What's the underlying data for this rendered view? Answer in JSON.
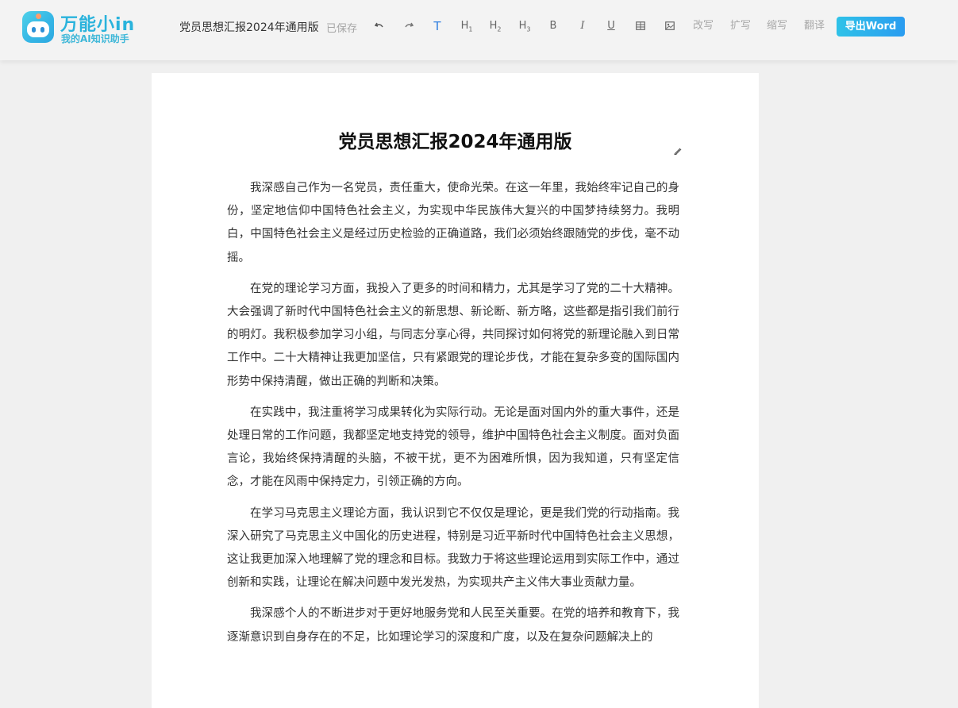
{
  "app": {
    "logo_title": "万能小in",
    "logo_subtitle": "我的AI知识助手"
  },
  "header": {
    "document_name": "党员思想汇报2024年通用版",
    "save_status": "已保存",
    "toolbar": {
      "undo_icon": "undo-icon",
      "redo_icon": "redo-icon",
      "text_style": "T",
      "h1": "H",
      "h1_sub": "1",
      "h2": "H",
      "h2_sub": "2",
      "h3": "H",
      "h3_sub": "3",
      "bold": "B",
      "italic": "I",
      "underline": "U",
      "table_icon": "table-icon",
      "image_icon": "image-icon",
      "rewrite": "改写",
      "expand": "扩写",
      "shorten": "缩写",
      "translate": "翻译",
      "export": "导出Word"
    },
    "colors": {
      "accent": "#2f7fe0",
      "export_start": "#2fc2e8",
      "export_end": "#2a9cf0",
      "logo": "#2ab3dc"
    }
  },
  "document": {
    "title": "党员思想汇报2024年通用版",
    "paragraphs": [
      "我深感自己作为一名党员，责任重大，使命光荣。在这一年里，我始终牢记自己的身份，坚定地信仰中国特色社会主义，为实现中华民族伟大复兴的中国梦持续努力。我明白，中国特色社会主义是经过历史检验的正确道路，我们必须始终跟随党的步伐，毫不动摇。",
      "在党的理论学习方面，我投入了更多的时间和精力，尤其是学习了党的二十大精神。大会强调了新时代中国特色社会主义的新思想、新论断、新方略，这些都是指引我们前行的明灯。我积极参加学习小组，与同志分享心得，共同探讨如何将党的新理论融入到日常工作中。二十大精神让我更加坚信，只有紧跟党的理论步伐，才能在复杂多变的国际国内形势中保持清醒，做出正确的判断和决策。",
      "在实践中，我注重将学习成果转化为实际行动。无论是面对国内外的重大事件，还是处理日常的工作问题，我都坚定地支持党的领导，维护中国特色社会主义制度。面对负面言论，我始终保持清醒的头脑，不被干扰，更不为困难所惧，因为我知道，只有坚定信念，才能在风雨中保持定力，引领正确的方向。",
      "在学习马克思主义理论方面，我认识到它不仅仅是理论，更是我们党的行动指南。我深入研究了马克思主义中国化的历史进程，特别是习近平新时代中国特色社会主义思想，这让我更加深入地理解了党的理念和目标。我致力于将这些理论运用到实际工作中，通过创新和实践，让理论在解决问题中发光发热，为实现共产主义伟大事业贡献力量。",
      "我深感个人的不断进步对于更好地服务党和人民至关重要。在党的培养和教育下，我逐渐意识到自身存在的不足，比如理论学习的深度和广度，以及在复杂问题解决上的"
    ]
  }
}
